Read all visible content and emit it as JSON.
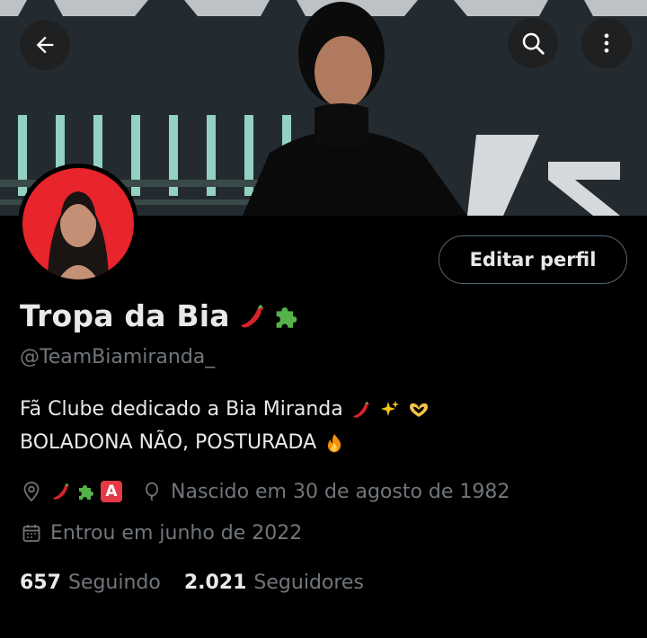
{
  "header": {
    "back_icon": "arrow-left-icon",
    "search_icon": "search-icon",
    "more_icon": "more-vertical-icon"
  },
  "profile": {
    "display_name": "Tropa da Bia",
    "handle": "@TeamBiamiranda_",
    "edit_button": "Editar perfil",
    "bio_line1": "Fã Clube dedicado a Bia Miranda",
    "bio_line2": "BOLADONA NÃO, POSTURADA",
    "location_badge_letter": "A",
    "birth": "Nascido em 30 de agosto de 1982",
    "joined": "Entrou em junho de 2022",
    "following_count": "657",
    "following_label": "Seguindo",
    "followers_count": "2.021",
    "followers_label": "Seguidores"
  },
  "colors": {
    "background": "#000000",
    "text_primary": "#e7e9ea",
    "text_secondary": "#71767b",
    "button_border": "#536471",
    "avatar_bg": "#e8242c",
    "chili": "#d9232a",
    "puzzle": "#55b24a",
    "sparkle": "#f5c518",
    "fire": "#f4900c"
  }
}
